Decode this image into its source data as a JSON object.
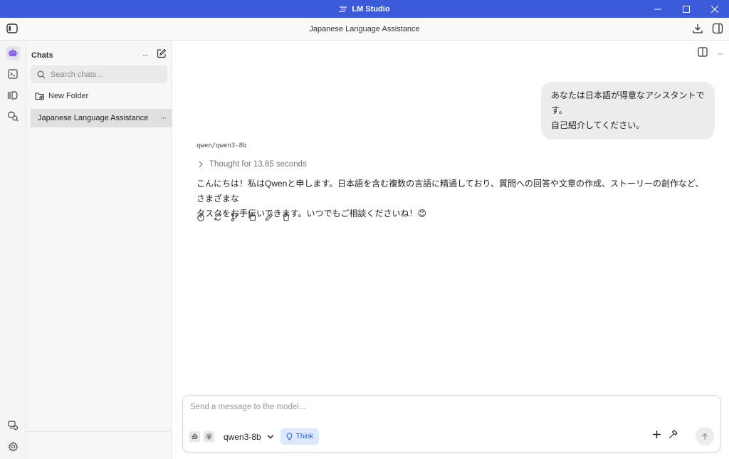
{
  "window": {
    "app_title": "LM Studio",
    "minimize": "—",
    "maximize": "☐",
    "close": "✕"
  },
  "header": {
    "title": "Japanese Language Assistance"
  },
  "sidebar": {
    "title": "Chats",
    "search_placeholder": "Search chats...",
    "new_folder_label": "New Folder",
    "chats": [
      {
        "label": "Japanese Language Assistance",
        "more": "···"
      }
    ],
    "more": "···"
  },
  "conversation": {
    "user_message_line1": "あなたは日本語が得意なアシスタントです。",
    "user_message_line2": "自己紹介してください。",
    "model_name": "qwen/qwen3-8b",
    "thought_label": "Thought for 13.85 seconds",
    "reply_line1": "こんにちは！私はQwenと申します。日本語を含む複数の言語に精通しており、質問への回答や文章の作成、ストーリーの創作など、さまざまな",
    "reply_line2": "タスクをお手伝いできます。いつでもご相談くださいね！😊"
  },
  "composer": {
    "placeholder": "Send a message to the model...",
    "model_select": "qwen3-8b",
    "think_label": "Think"
  },
  "colors": {
    "titlebar": "#3b5bdb",
    "accent_think_bg": "#dce8fb",
    "accent_think_text": "#2b5fc9",
    "logo": "#8b5cf6"
  }
}
